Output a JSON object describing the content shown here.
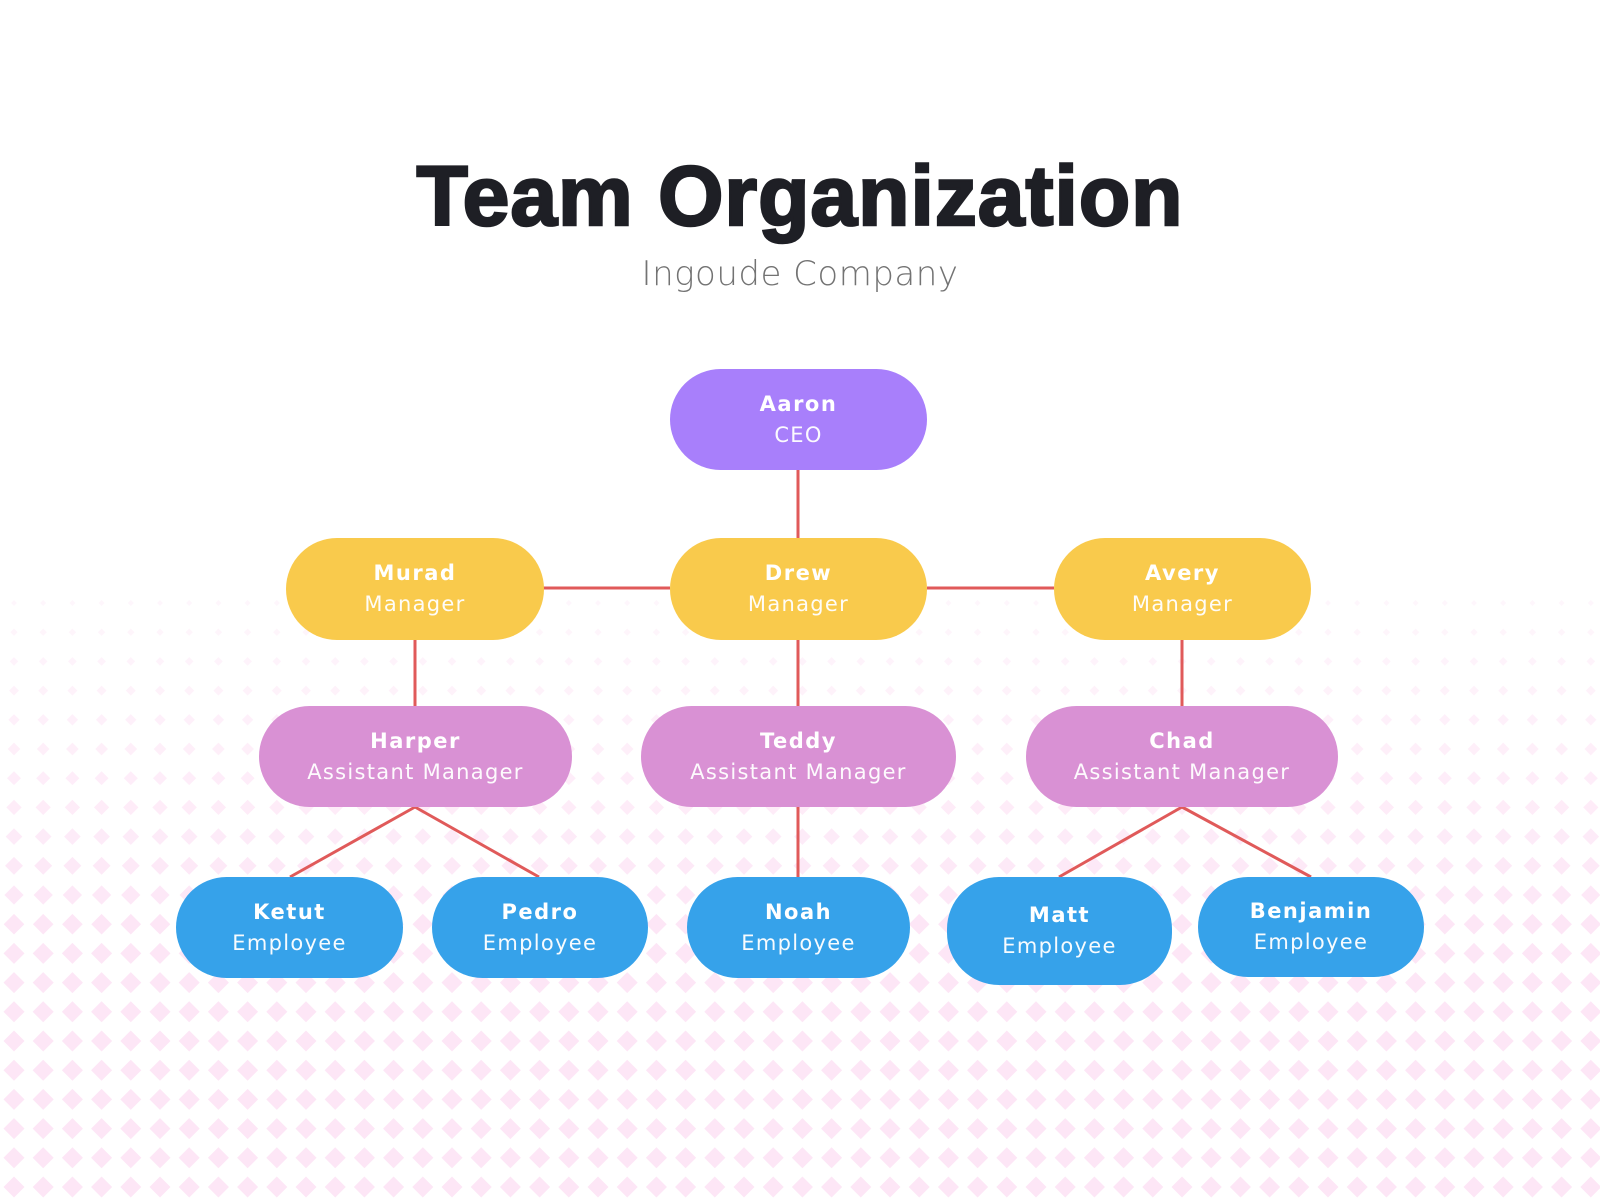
{
  "header": {
    "title": "Team Organization",
    "subtitle": "Ingoude Company"
  },
  "colors": {
    "ceo": "#a87ffb",
    "manager": "#f9ca4c",
    "assistant_manager": "#d991d4",
    "employee": "#36a2ea",
    "connector": "#e05a5a",
    "pattern": "#fde6f6"
  },
  "org": {
    "ceo": {
      "name": "Aaron",
      "role": "CEO"
    },
    "managers": [
      {
        "name": "Murad",
        "role": "Manager"
      },
      {
        "name": "Drew",
        "role": "Manager"
      },
      {
        "name": "Avery",
        "role": "Manager"
      }
    ],
    "assistant_managers": [
      {
        "name": "Harper",
        "role": "Assistant Manager",
        "reports_to": "Murad"
      },
      {
        "name": "Teddy",
        "role": "Assistant Manager",
        "reports_to": "Drew"
      },
      {
        "name": "Chad",
        "role": "Assistant Manager",
        "reports_to": "Avery"
      }
    ],
    "employees": [
      {
        "name": "Ketut",
        "role": "Employee",
        "reports_to": "Harper"
      },
      {
        "name": "Pedro",
        "role": "Employee",
        "reports_to": "Harper"
      },
      {
        "name": "Noah",
        "role": "Employee",
        "reports_to": "Teddy"
      },
      {
        "name": "Matt",
        "role": "Employee",
        "reports_to": "Chad"
      },
      {
        "name": "Benjamin",
        "role": "Employee",
        "reports_to": "Chad"
      }
    ]
  }
}
